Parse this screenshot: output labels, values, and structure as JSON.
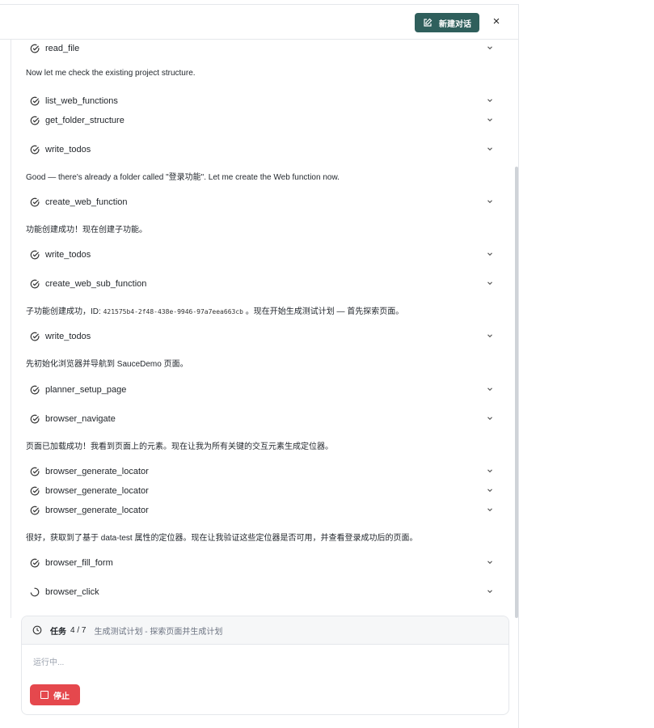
{
  "header": {
    "new_chat_label": "新建对话",
    "close_label": "×"
  },
  "timeline": [
    {
      "kind": "tool",
      "name": "read_file",
      "status": "done"
    },
    {
      "kind": "msg",
      "text": "Now let me check the existing project structure."
    },
    {
      "kind": "tool",
      "name": "list_web_functions",
      "status": "done"
    },
    {
      "kind": "tool",
      "name": "get_folder_structure",
      "status": "done"
    },
    {
      "kind": "tool",
      "name": "write_todos",
      "status": "done"
    },
    {
      "kind": "msg",
      "text": "Good — there's already a folder called \"登录功能\". Let me create the Web function now."
    },
    {
      "kind": "tool",
      "name": "create_web_function",
      "status": "done"
    },
    {
      "kind": "msg",
      "text": "功能创建成功！现在创建子功能。"
    },
    {
      "kind": "tool",
      "name": "write_todos",
      "status": "done"
    },
    {
      "kind": "tool",
      "name": "create_web_sub_function",
      "status": "done"
    },
    {
      "kind": "msg_id",
      "prefix": "子功能创建成功，ID: ",
      "id": "421575b4-2f48-438e-9946-97a7eea663cb",
      "suffix": " 。现在开始生成测试计划 — 首先探索页面。"
    },
    {
      "kind": "tool",
      "name": "write_todos",
      "status": "done"
    },
    {
      "kind": "msg",
      "text": "先初始化浏览器并导航到 SauceDemo 页面。"
    },
    {
      "kind": "tool",
      "name": "planner_setup_page",
      "status": "done"
    },
    {
      "kind": "tool",
      "name": "browser_navigate",
      "status": "done"
    },
    {
      "kind": "msg",
      "text": "页面已加载成功！我看到页面上的元素。现在让我为所有关键的交互元素生成定位器。"
    },
    {
      "kind": "tool",
      "name": "browser_generate_locator",
      "status": "done"
    },
    {
      "kind": "tool",
      "name": "browser_generate_locator",
      "status": "done"
    },
    {
      "kind": "tool",
      "name": "browser_generate_locator",
      "status": "done"
    },
    {
      "kind": "msg",
      "text": "很好，获取到了基于 data-test 属性的定位器。现在让我验证这些定位器是否可用，并查看登录成功后的页面。"
    },
    {
      "kind": "tool",
      "name": "browser_fill_form",
      "status": "done"
    },
    {
      "kind": "tool",
      "name": "browser_click",
      "status": "running"
    }
  ],
  "task": {
    "label": "任务",
    "count": "4 / 7",
    "description": "生成测试计划 - 探索页面并生成计划",
    "running_text": "运行中...",
    "stop_label": "停止"
  },
  "colors": {
    "primary": "#2f5f5c",
    "danger": "#e5484d"
  },
  "icons": {
    "done": "check-circle-icon",
    "running": "spinner-icon",
    "expand": "chevron-down-icon",
    "task": "clock-icon",
    "new_chat": "edit-icon"
  }
}
